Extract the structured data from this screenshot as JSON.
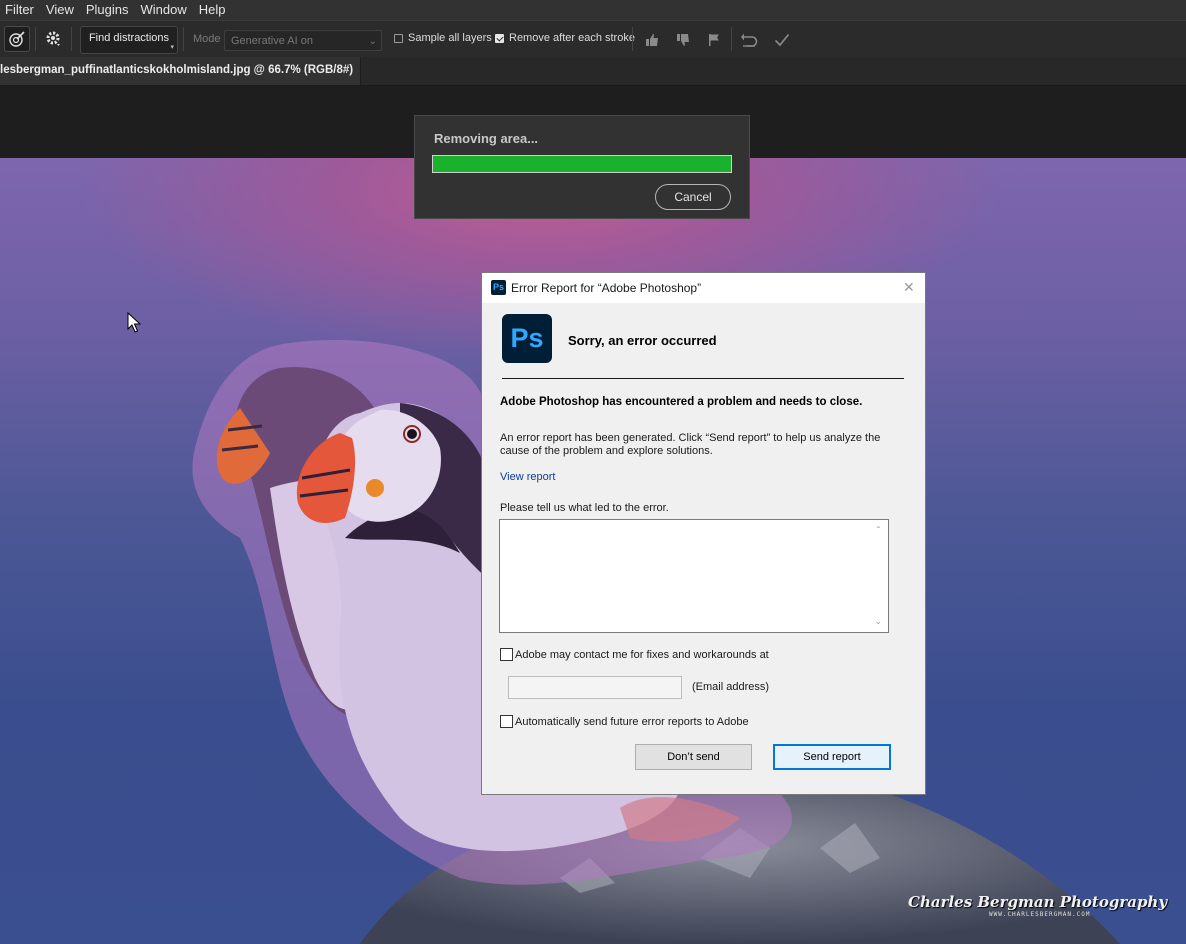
{
  "menu": {
    "items": [
      "Filter",
      "View",
      "Plugins",
      "Window",
      "Help"
    ]
  },
  "options": {
    "find_distractions": "Find distractions",
    "mode_label": "Mode",
    "mode_value": "Generative AI on",
    "sample_all_layers": "Sample all layers",
    "sample_all_layers_checked": false,
    "remove_after_each_stroke": "Remove after each stroke",
    "remove_after_each_stroke_checked": true
  },
  "document": {
    "tab_title": "lesbergman_puffinatlanticskokholmisland.jpg @ 66.7% (RGB/8#)",
    "close_glyph": "×"
  },
  "removing_dialog": {
    "title": "Removing area...",
    "progress_percent": 100,
    "progress_color": "#1ab22c",
    "cancel_label": "Cancel"
  },
  "error_dialog": {
    "title": "Error Report for “Adobe Photoshop”",
    "close_glyph": "✕",
    "ps_icon_text": "Ps",
    "heading": "Sorry, an error occurred",
    "bold_message": "Adobe Photoshop has encountered a problem and needs to close.",
    "description": "An error report has been generated. Click “Send report” to help us analyze the cause of the problem and explore solutions.",
    "view_report": "View report",
    "prompt": "Please tell us what led to the error.",
    "feedback_value": "",
    "contact_label": "Adobe may contact me for fixes and workarounds at",
    "contact_checked": false,
    "email_value": "",
    "email_label": "(Email address)",
    "auto_send_label": "Automatically send future error reports to Adobe",
    "auto_send_checked": false,
    "dont_send": "Don’t send",
    "send_report": "Send report"
  },
  "watermark": {
    "name": "Charles Bergman Photography",
    "url": "WWW.CHARLESBERGMAN.COM"
  }
}
